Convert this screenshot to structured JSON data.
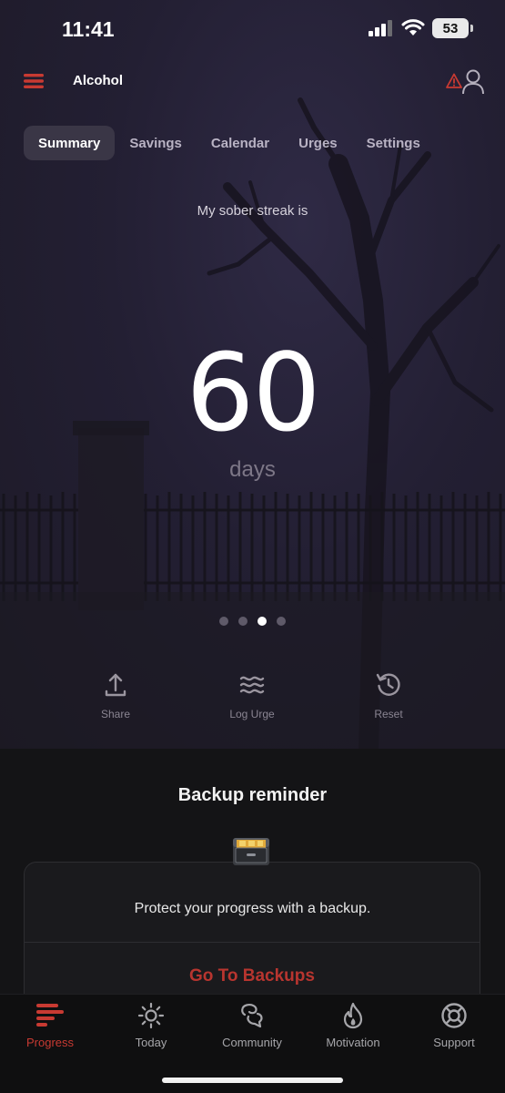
{
  "status_bar": {
    "time": "11:41",
    "battery": "53"
  },
  "header": {
    "title": "Alcohol",
    "menu_icon": "hamburger-menu-icon",
    "alert_icon": "warning-triangle-icon",
    "profile_icon": "profile-icon"
  },
  "tabs": [
    {
      "label": "Summary",
      "active": true
    },
    {
      "label": "Savings",
      "active": false
    },
    {
      "label": "Calendar",
      "active": false
    },
    {
      "label": "Urges",
      "active": false
    },
    {
      "label": "Settings",
      "active": false
    }
  ],
  "streak": {
    "caption": "My sober streak is",
    "value": "60",
    "unit": "days"
  },
  "pager": {
    "count": 4,
    "active_index": 2
  },
  "actions": [
    {
      "label": "Share",
      "icon": "share-icon"
    },
    {
      "label": "Log Urge",
      "icon": "waves-icon"
    },
    {
      "label": "Reset",
      "icon": "history-reset-icon"
    }
  ],
  "backup": {
    "title": "Backup reminder",
    "icon": "file-cabinet-icon",
    "message": "Protect your progress with a backup.",
    "button_label": "Go To Backups"
  },
  "bottom_nav": [
    {
      "label": "Progress",
      "icon": "progress-bars-icon",
      "active": true
    },
    {
      "label": "Today",
      "icon": "sun-icon",
      "active": false
    },
    {
      "label": "Community",
      "icon": "community-chat-icon",
      "active": false
    },
    {
      "label": "Motivation",
      "icon": "flame-icon",
      "active": false
    },
    {
      "label": "Support",
      "icon": "lifebuoy-icon",
      "active": false
    }
  ],
  "colors": {
    "accent": "#c83a32",
    "background": "#141416",
    "hero": "#231f33"
  }
}
